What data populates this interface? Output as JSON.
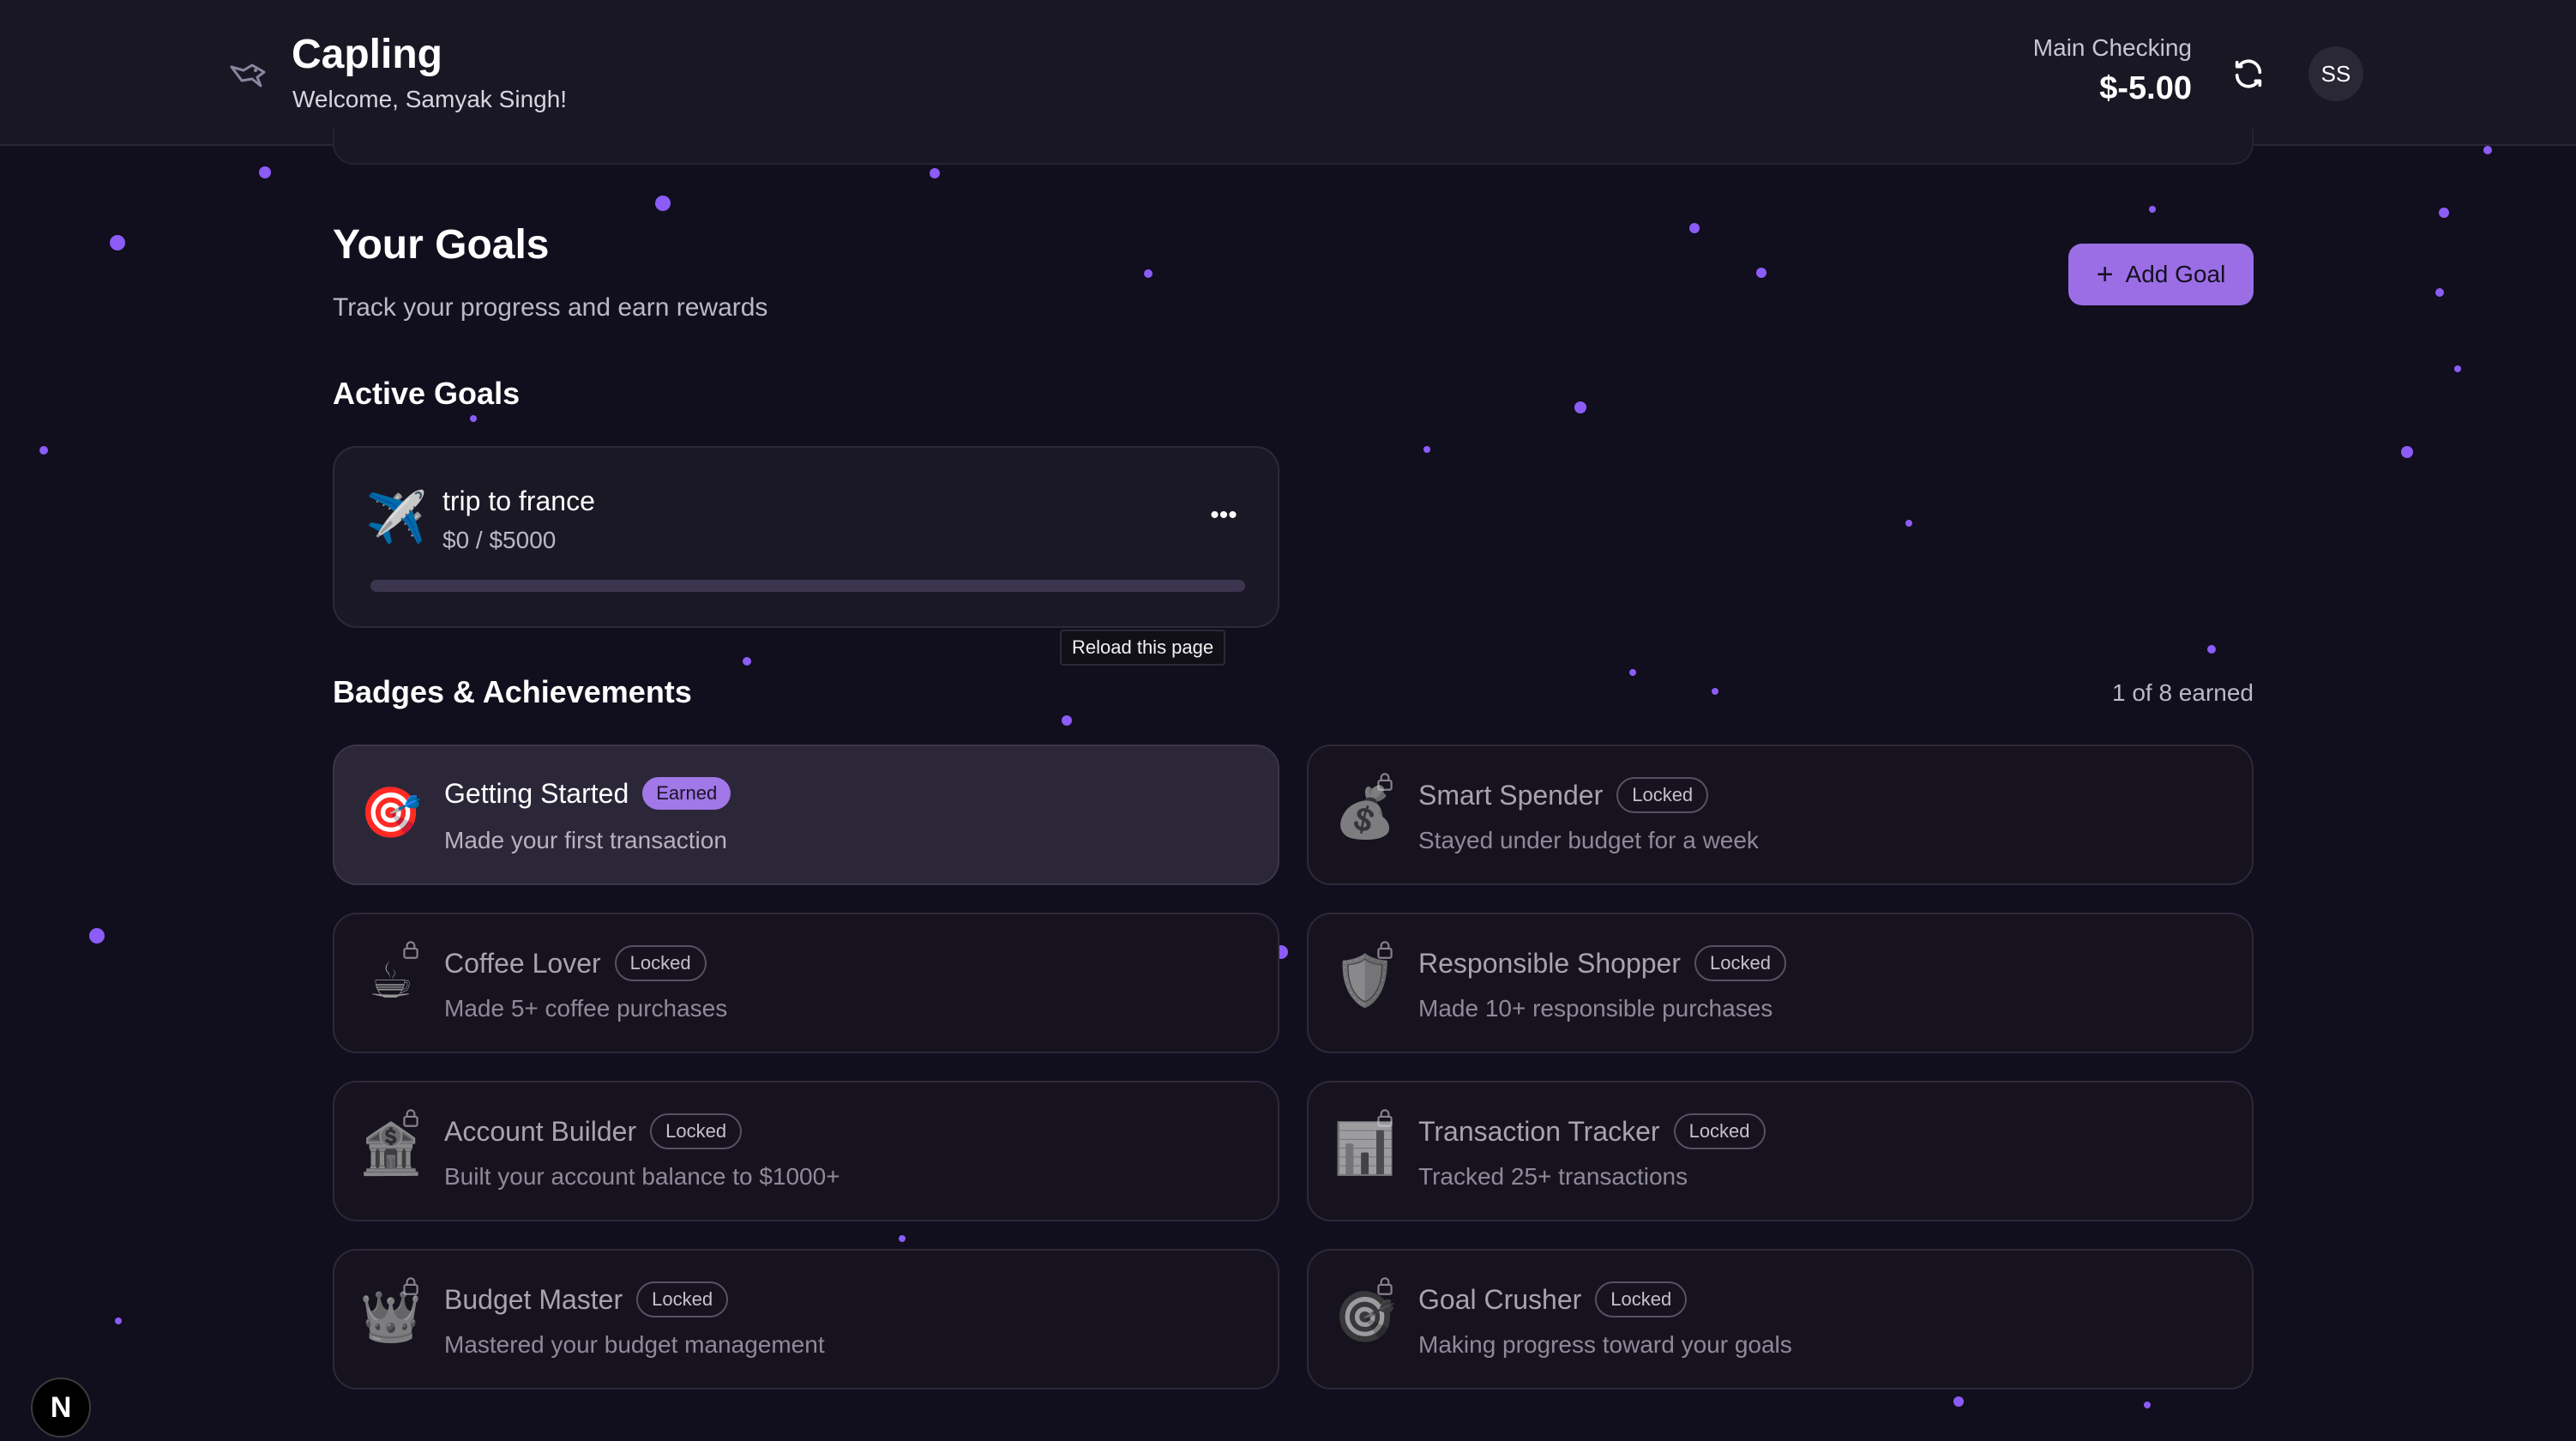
{
  "header": {
    "app_name": "Capling",
    "welcome": "Welcome, Samyak Singh!",
    "account_name": "Main Checking",
    "account_balance": "$-5.00",
    "avatar_initials": "SS"
  },
  "goals_page": {
    "title": "Your Goals",
    "subtitle": "Track your progress and earn rewards",
    "add_goal_label": "Add Goal",
    "active_goals_title": "Active Goals"
  },
  "goals": [
    {
      "icon": "✈️",
      "name": "trip to france",
      "amount": "$0 / $5000",
      "progress": 0,
      "menu": "•••"
    }
  ],
  "tooltip": "Reload this page",
  "badges_section": {
    "title": "Badges & Achievements",
    "earned_count": "1 of 8 earned"
  },
  "badges": [
    {
      "icon": "🎯",
      "name": "Getting Started",
      "status": "Earned",
      "desc": "Made your first transaction"
    },
    {
      "icon": "💰",
      "name": "Smart Spender",
      "status": "Locked",
      "desc": "Stayed under budget for a week"
    },
    {
      "icon": "☕",
      "name": "Coffee Lover",
      "status": "Locked",
      "desc": "Made 5+ coffee purchases"
    },
    {
      "icon": "🛡️",
      "name": "Responsible Shopper",
      "status": "Locked",
      "desc": "Made 10+ responsible purchases"
    },
    {
      "icon": "🏦",
      "name": "Account Builder",
      "status": "Locked",
      "desc": "Built your account balance to $1000+"
    },
    {
      "icon": "📊",
      "name": "Transaction Tracker",
      "status": "Locked",
      "desc": "Tracked 25+ transactions"
    },
    {
      "icon": "👑",
      "name": "Budget Master",
      "status": "Locked",
      "desc": "Mastered your budget management"
    },
    {
      "icon": "🎯",
      "name": "Goal Crusher",
      "status": "Locked",
      "desc": "Making progress toward your goals"
    }
  ],
  "dev_indicator": "N",
  "colors": {
    "accent": "#9b6ee6",
    "background": "#110e1d",
    "card": "#1b1826"
  }
}
